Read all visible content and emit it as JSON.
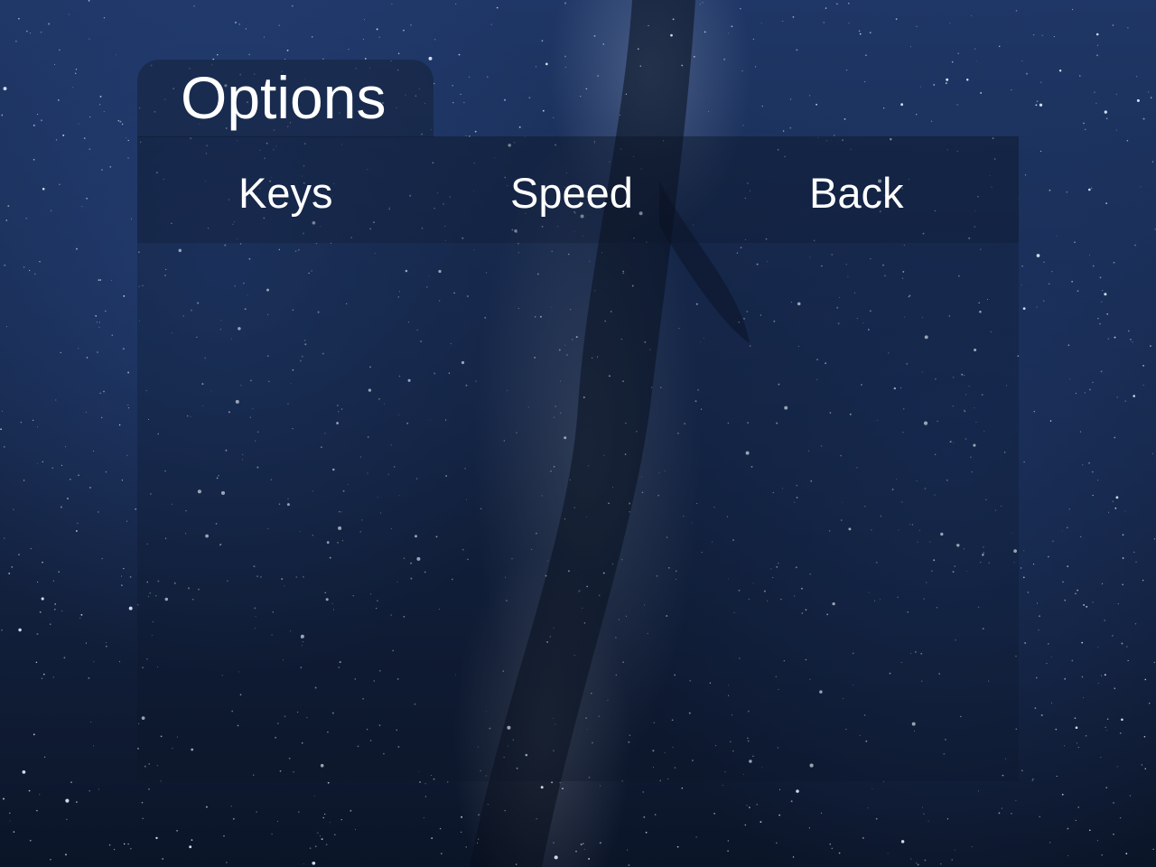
{
  "screen": {
    "title": "Options"
  },
  "menu": {
    "items": [
      {
        "label": "Keys"
      },
      {
        "label": "Speed"
      },
      {
        "label": "Back"
      }
    ]
  },
  "theme": {
    "background": "starry night sky with milky way",
    "text_color": "#ffffff",
    "panel_color": "#0c1426"
  }
}
